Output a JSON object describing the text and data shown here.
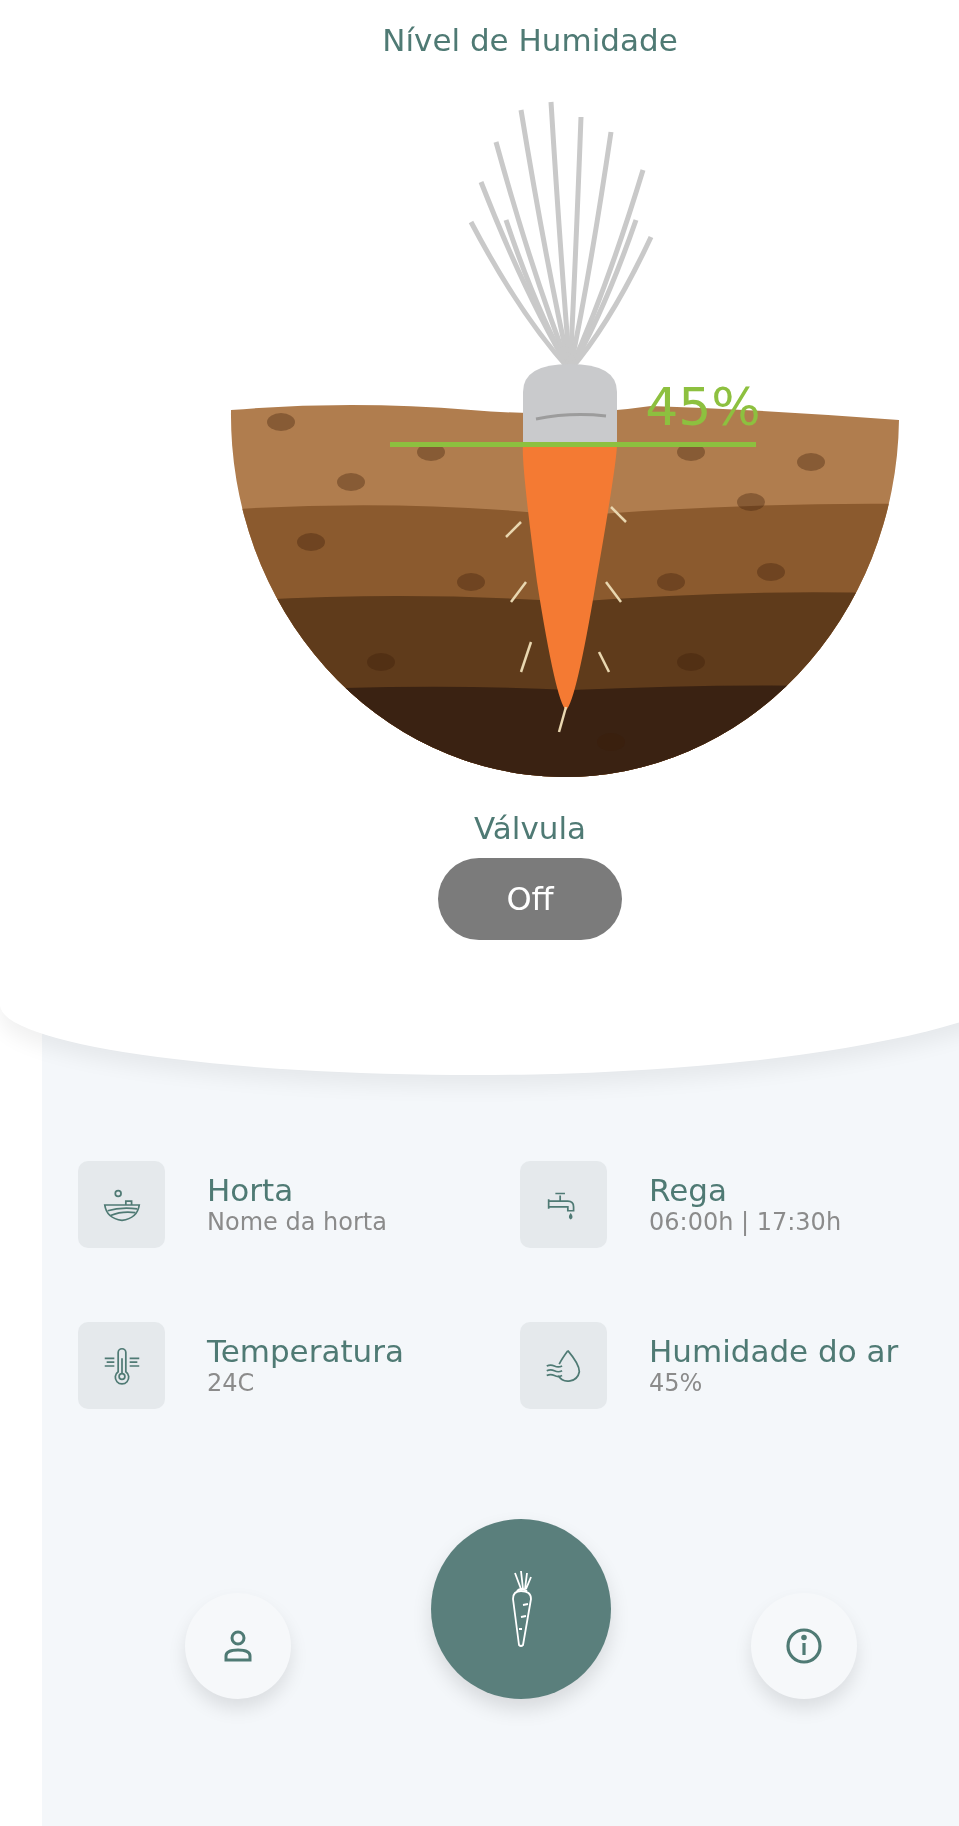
{
  "title": "Nível de Humidade",
  "moisture": {
    "reading": "45%"
  },
  "valve": {
    "label": "Válvula",
    "on": false,
    "state_text": "Off"
  },
  "info_cards": [
    {
      "kind": "garden",
      "title": "Horta",
      "value": "Nome da horta"
    },
    {
      "kind": "tap",
      "title": "Rega",
      "value": "06:00h | 17:30h"
    },
    {
      "kind": "thermometer",
      "title": "Temperatura",
      "value": "24C"
    },
    {
      "kind": "humidity",
      "title": "Humidade do ar",
      "value": "45%"
    }
  ],
  "nav": [
    {
      "kind": "profile",
      "selected": false
    },
    {
      "kind": "carrot",
      "selected": true
    },
    {
      "kind": "info",
      "selected": false
    }
  ]
}
